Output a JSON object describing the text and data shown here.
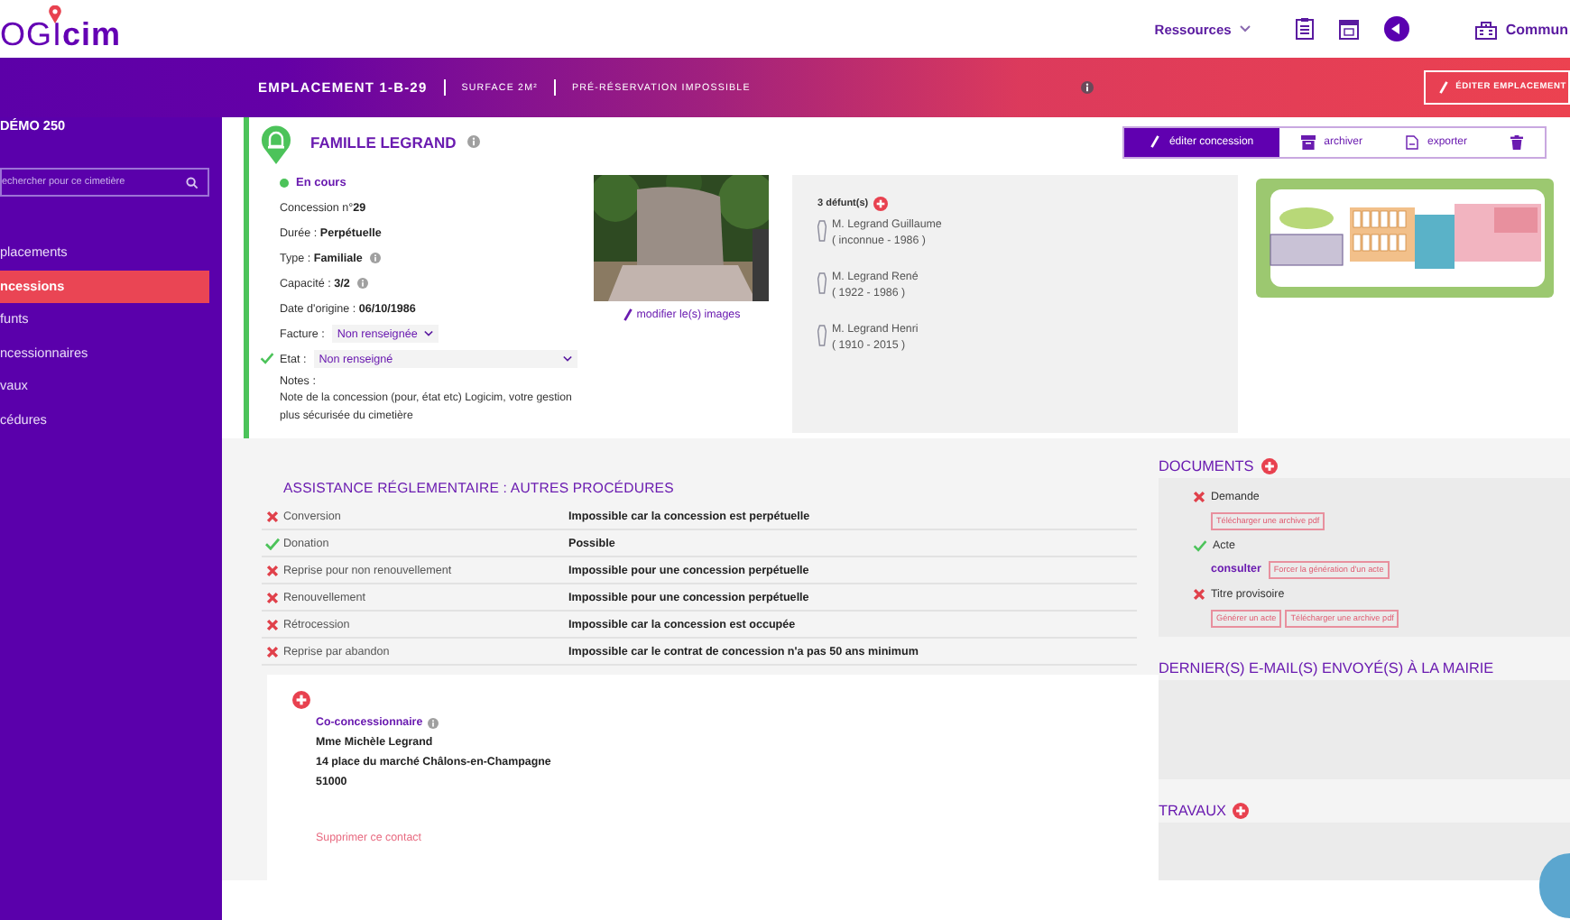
{
  "topbar": {
    "logo": "OGI**cim**",
    "resources_menu": "Ressources",
    "commune": "Commun"
  },
  "band": {
    "location": "EMPLACEMENT 1-B-29",
    "surface": "SURFACE 2M²",
    "reservation": "PRÉ-RÉSERVATION IMPOSSIBLE",
    "edit_button": "ÉDITER EMPLACEMENT"
  },
  "sidebar": {
    "title": "DÉMO 250",
    "search": {
      "placeholder": "echercher pour ce cimetière"
    },
    "items": [
      {
        "label": "placements",
        "selected": false
      },
      {
        "label": "ncessions",
        "selected": true
      },
      {
        "label": "funts",
        "selected": false
      },
      {
        "label": "ncessionnaires",
        "selected": false
      },
      {
        "label": "vaux",
        "selected": false
      },
      {
        "label": "cédures",
        "selected": false
      }
    ]
  },
  "concession": {
    "title": "FAMILLE LEGRAND",
    "status": "En cours",
    "toolbar": [
      {
        "kind": "edit",
        "label": "éditer concession",
        "selected": true
      },
      {
        "kind": "archive",
        "label": "archiver",
        "selected": false
      },
      {
        "kind": "export",
        "label": "exporter",
        "selected": false
      },
      {
        "kind": "delete",
        "selected": false
      }
    ],
    "fields": [
      {
        "kind": "text",
        "text": "Concession n°**29**"
      },
      {
        "kind": "text",
        "text": "Durée : **Perpétuelle**"
      },
      {
        "kind": "text",
        "text": "Type : **Familiale**",
        "info": true
      },
      {
        "kind": "text",
        "text": "Capacité : **3/2**",
        "info": true
      },
      {
        "kind": "text",
        "text": "Date d'origine : **06/10/1986**"
      },
      {
        "kind": "inline_select",
        "label": "Facture :",
        "value": "Non renseignée",
        "checked": false
      },
      {
        "kind": "wide_select",
        "label": "Etat :",
        "value": "Non renseigné",
        "checked": true
      }
    ],
    "notes": {
      "label": "Notes :",
      "text": "Note de la concession (pour, état etc) Logicim, votre gestion plus sécurisée du cimetière"
    },
    "image_link": "modifier le(s) images",
    "deceased": {
      "count": "3 défunt(s)",
      "people": [
        {
          "name": "M. Legrand Guillaume",
          "dates": "( inconnue - 1986 )"
        },
        {
          "name": "M. Legrand René",
          "dates": "( 1922 - 1986 )"
        },
        {
          "name": "M. Legrand Henri",
          "dates": "( 1910 - 2015 )"
        }
      ]
    }
  },
  "procedures": {
    "title": "ASSISTANCE RÉGLEMENTAIRE : AUTRES PROCÉDURES",
    "rows": [
      {
        "name": "Conversion",
        "result": "Impossible car la concession est perpétuelle",
        "possible": false
      },
      {
        "name": "Donation",
        "result": "Possible",
        "possible": true
      },
      {
        "name": "Reprise pour non renouvellement",
        "result": "Impossible pour une concession perpétuelle",
        "possible": false
      },
      {
        "name": "Renouvellement",
        "result": "Impossible pour une concession perpétuelle",
        "possible": false
      },
      {
        "name": "Rétrocession",
        "result": "Impossible car la concession est occupée",
        "possible": false
      },
      {
        "name": "Reprise par abandon",
        "result": "Impossible car le contrat de concession n'a pas 50 ans minimum",
        "possible": false
      }
    ]
  },
  "co_holder": {
    "role": "Co-concessionnaire",
    "name": "Mme Michèle Legrand",
    "address": "14 place du marché Châlons-en-Champagne",
    "postcode": "51000",
    "delete_link": "Supprimer ce contact"
  },
  "documents": {
    "title": "DOCUMENTS",
    "items": [
      {
        "name": "Demande",
        "available": false,
        "actions": [
          "Télécharger une archive pdf"
        ]
      },
      {
        "name": "Acte",
        "available": true,
        "link": "consulter",
        "actions": [
          "Forcer la génération d'un acte"
        ]
      },
      {
        "name": "Titre provisoire",
        "available": false,
        "actions": [
          "Générer un acte",
          "Télécharger une archive pdf"
        ]
      }
    ]
  },
  "emails": {
    "title": "DERNIER(S) E-MAIL(S) ENVOYÉ(S) À LA MAIRIE"
  },
  "works": {
    "title": "TRAVAUX"
  }
}
